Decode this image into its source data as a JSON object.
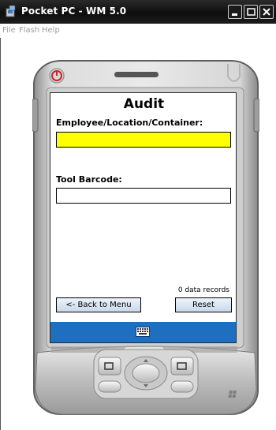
{
  "window": {
    "title": "Pocket PC - WM 5.0",
    "menu": [
      "File",
      "Flash",
      "Help"
    ],
    "controls": [
      "minimize-icon",
      "maximize-icon",
      "close-icon"
    ]
  },
  "form": {
    "title": "Audit",
    "employee_label": "Employee/Location/Container:",
    "employee_value": "",
    "tool_label": "Tool Barcode:",
    "tool_value": "",
    "records_status": "0 data records",
    "back_button": "<- Back to Menu",
    "reset_button": "Reset"
  },
  "sip": {
    "icon": "keyboard-icon"
  },
  "colors": {
    "field_highlight": "#ffff00",
    "sip_bar": "#1f6fc1",
    "titlebar": "#141414"
  }
}
